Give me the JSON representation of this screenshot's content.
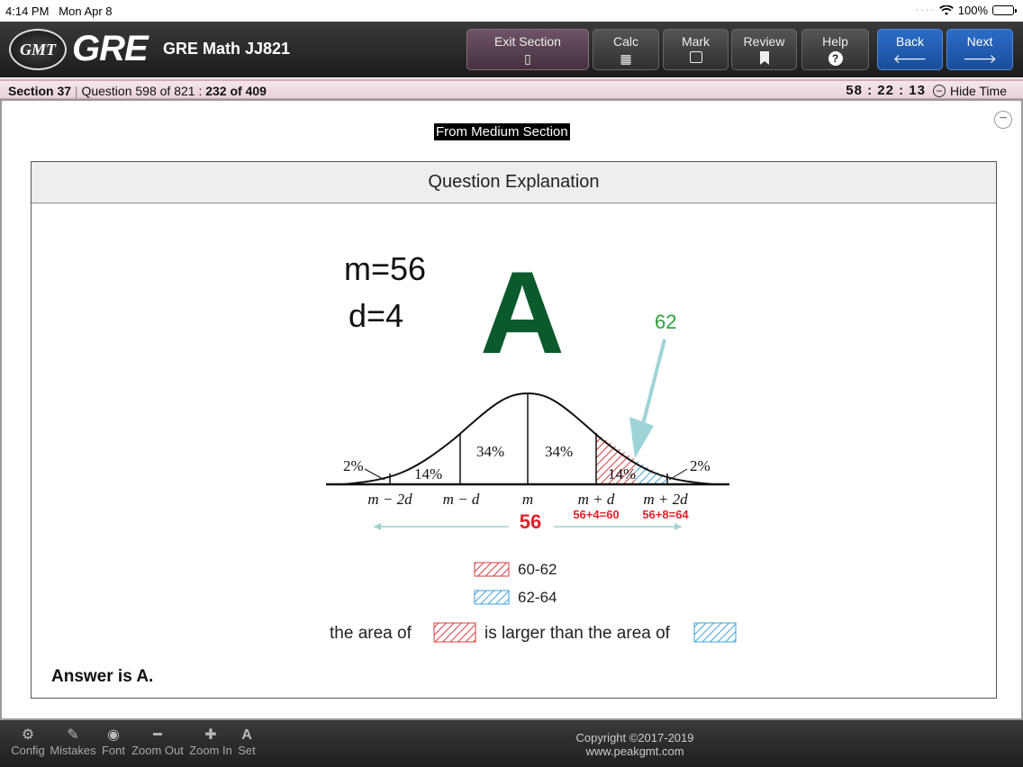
{
  "status_bar": {
    "time": "4:14 PM",
    "date": "Mon Apr 8",
    "battery": "100%"
  },
  "header": {
    "logo_badge": "GMT",
    "logo_text": "GRE",
    "title": "GRE Math JJ821",
    "buttons": {
      "exit": "Exit Section",
      "calc": "Calc",
      "mark": "Mark",
      "review": "Review",
      "help": "Help",
      "back": "Back",
      "next": "Next"
    }
  },
  "section_bar": {
    "section_label": "Section 37",
    "question_info": "Question 598 of 821",
    "progress": "232 of 409",
    "timer": "58 : 22 : 13",
    "hide_time": "Hide Time"
  },
  "content": {
    "source_tag": "From Medium Section",
    "panel_title": "Question Explanation",
    "answer_text": "Answer is A.",
    "figure": {
      "m_label": "m=56",
      "d_label": "d=4",
      "big_answer": "A",
      "arrow_label": "62",
      "percents": {
        "far_left": "2%",
        "left": "14%",
        "center_left": "34%",
        "center_right": "34%",
        "right": "14%",
        "far_right": "2%"
      },
      "axis_ticks": {
        "m_minus_2d": "m − 2d",
        "m_minus_d": "m − d",
        "m": "m",
        "m_plus_d": "m + d",
        "m_plus_2d": "m + 2d"
      },
      "calc_labels": {
        "mean_value": "56",
        "plus_d": "56+4=60",
        "plus_2d": "56+8=64"
      },
      "legend": {
        "red": "60-62",
        "blue": "62-64"
      },
      "comparison": {
        "prefix": "the area of",
        "middle": "is larger than the area of"
      }
    }
  },
  "bottom_bar": {
    "items": [
      "Config",
      "Mistakes",
      "Font",
      "Zoom Out",
      "Zoom In",
      "Set"
    ],
    "copyright_line1": "Copyright ©2017-2019",
    "copyright_line2": "www.peakgmt.com"
  },
  "colors": {
    "accent_blue": "#2c6cc8",
    "answer_green": "#0b5a2c",
    "red_calc": "#e0202a",
    "arrow_teal": "#9ed4d8"
  }
}
